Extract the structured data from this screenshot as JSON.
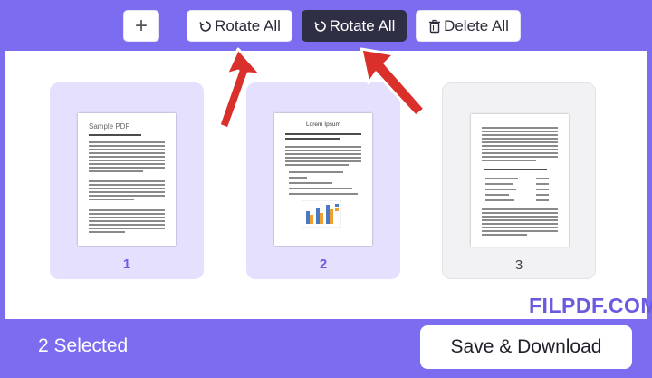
{
  "toolbar": {
    "add_label": "+",
    "rotate_all_1": "Rotate All",
    "rotate_all_2": "Rotate All",
    "delete_all": "Delete All"
  },
  "pages": [
    {
      "number": "1",
      "selected": true,
      "title": "Sample PDF"
    },
    {
      "number": "2",
      "selected": true,
      "title": "Lorem Ipsum"
    },
    {
      "number": "3",
      "selected": false,
      "title": ""
    }
  ],
  "footer": {
    "selected_text": "2 Selected",
    "save_label": "Save & Download"
  },
  "watermark": "FILPDF.COM",
  "colors": {
    "brand": "#7b6cf0",
    "dark_button": "#2e2f45",
    "selected_card": "#e4e0fd",
    "arrow": "#d9302b"
  },
  "icons": [
    "plus-icon",
    "rotate-icon",
    "trash-icon"
  ]
}
